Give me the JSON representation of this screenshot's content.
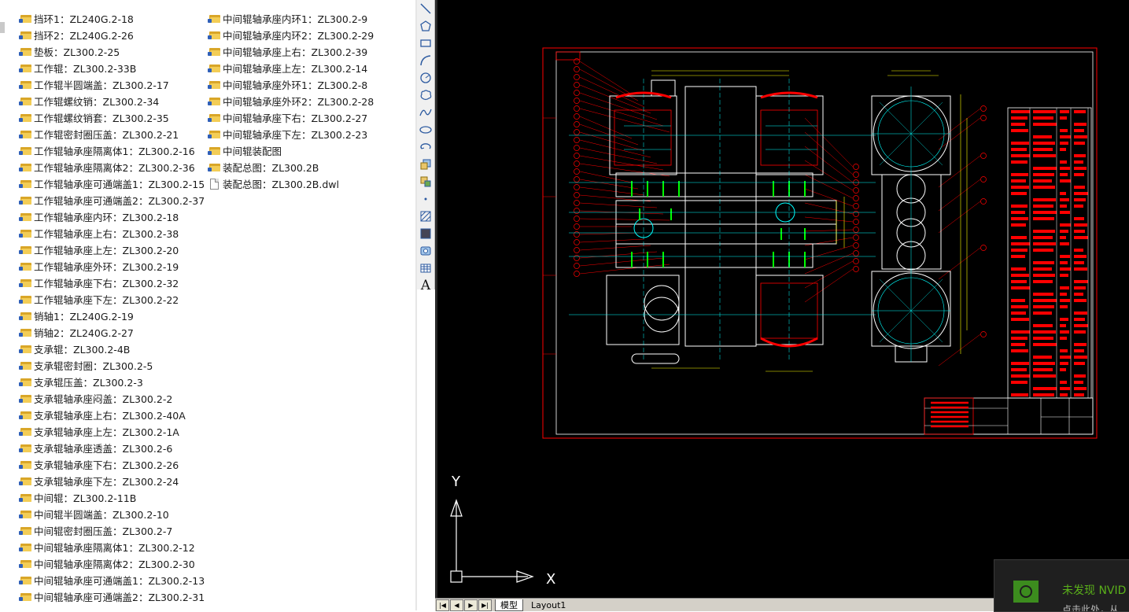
{
  "explorer": {
    "column_a": [
      {
        "name": "挡环1：ZL240G.2-18",
        "type": "folder"
      },
      {
        "name": "挡环2：ZL240G.2-26",
        "type": "folder"
      },
      {
        "name": "垫板：ZL300.2-25",
        "type": "folder"
      },
      {
        "name": "工作辊：ZL300.2-33B",
        "type": "folder"
      },
      {
        "name": "工作辊半圆端盖：ZL300.2-17",
        "type": "folder"
      },
      {
        "name": "工作辊螺纹销：ZL300.2-34",
        "type": "folder"
      },
      {
        "name": "工作辊螺纹销套：ZL300.2-35",
        "type": "folder"
      },
      {
        "name": "工作辊密封圈压盖：ZL300.2-21",
        "type": "folder"
      },
      {
        "name": "工作辊轴承座隔离体1：ZL300.2-16",
        "type": "folder"
      },
      {
        "name": "工作辊轴承座隔离体2：ZL300.2-36",
        "type": "folder"
      },
      {
        "name": "工作辊轴承座可通端盖1：ZL300.2-15",
        "type": "folder"
      },
      {
        "name": "工作辊轴承座可通端盖2：ZL300.2-37",
        "type": "folder"
      },
      {
        "name": "工作辊轴承座内环：ZL300.2-18",
        "type": "folder"
      },
      {
        "name": "工作辊轴承座上右：ZL300.2-38",
        "type": "folder"
      },
      {
        "name": "工作辊轴承座上左：ZL300.2-20",
        "type": "folder"
      },
      {
        "name": "工作辊轴承座外环：ZL300.2-19",
        "type": "folder"
      },
      {
        "name": "工作辊轴承座下右：ZL300.2-32",
        "type": "folder"
      },
      {
        "name": "工作辊轴承座下左：ZL300.2-22",
        "type": "folder"
      },
      {
        "name": "销轴1：ZL240G.2-19",
        "type": "folder"
      },
      {
        "name": "销轴2：ZL240G.2-27",
        "type": "folder"
      },
      {
        "name": "支承辊：ZL300.2-4B",
        "type": "folder"
      },
      {
        "name": "支承辊密封圈：ZL300.2-5",
        "type": "folder"
      },
      {
        "name": "支承辊压盖：ZL300.2-3",
        "type": "folder"
      },
      {
        "name": "支承辊轴承座闷盖：ZL300.2-2",
        "type": "folder"
      },
      {
        "name": "支承辊轴承座上右：ZL300.2-40A",
        "type": "folder"
      },
      {
        "name": "支承辊轴承座上左：ZL300.2-1A",
        "type": "folder"
      },
      {
        "name": "支承辊轴承座透盖：ZL300.2-6",
        "type": "folder"
      },
      {
        "name": "支承辊轴承座下右：ZL300.2-26",
        "type": "folder"
      },
      {
        "name": "支承辊轴承座下左：ZL300.2-24",
        "type": "folder"
      },
      {
        "name": "中间辊：ZL300.2-11B",
        "type": "folder"
      },
      {
        "name": "中间辊半圆端盖：ZL300.2-10",
        "type": "folder"
      },
      {
        "name": "中间辊密封圈压盖：ZL300.2-7",
        "type": "folder"
      },
      {
        "name": "中间辊轴承座隔离体1：ZL300.2-12",
        "type": "folder"
      },
      {
        "name": "中间辊轴承座隔离体2：ZL300.2-30",
        "type": "folder"
      },
      {
        "name": "中间辊轴承座可通端盖1：ZL300.2-13",
        "type": "folder"
      },
      {
        "name": "中间辊轴承座可通端盖2：ZL300.2-31",
        "type": "folder"
      }
    ],
    "column_b": [
      {
        "name": "中间辊轴承座内环1：ZL300.2-9",
        "type": "folder"
      },
      {
        "name": "中间辊轴承座内环2：ZL300.2-29",
        "type": "folder"
      },
      {
        "name": "中间辊轴承座上右：ZL300.2-39",
        "type": "folder"
      },
      {
        "name": "中间辊轴承座上左：ZL300.2-14",
        "type": "folder"
      },
      {
        "name": "中间辊轴承座外环1：ZL300.2-8",
        "type": "folder"
      },
      {
        "name": "中间辊轴承座外环2：ZL300.2-28",
        "type": "folder"
      },
      {
        "name": "中间辊轴承座下右：ZL300.2-27",
        "type": "folder"
      },
      {
        "name": "中间辊轴承座下左：ZL300.2-23",
        "type": "folder"
      },
      {
        "name": "中间辊装配图",
        "type": "folder"
      },
      {
        "name": "装配总图：ZL300.2B",
        "type": "folder"
      },
      {
        "name": "装配总图：ZL300.2B.dwl",
        "type": "file"
      }
    ]
  },
  "toolbar": {
    "tools": [
      "line-tool-icon",
      "polygon-icon",
      "rectangle-icon",
      "arc-icon",
      "circle-icon",
      "revision-cloud-icon",
      "spline-icon",
      "ellipse-icon",
      "ellipse-arc-icon",
      "insert-block-icon",
      "make-block-icon",
      "point-icon",
      "hatch-icon",
      "gradient-icon",
      "region-icon",
      "table-icon",
      "multiline-text-icon"
    ],
    "text_tool_label": "A"
  },
  "canvas": {
    "background": "#000000",
    "ucs": {
      "x_label": "X",
      "y_label": "Y"
    }
  },
  "layout_tabs": {
    "tabs": [
      "模型",
      "Layout1"
    ],
    "active": "模型"
  },
  "notification": {
    "title": "未发现 NVID",
    "subtitle": "点击此处，从",
    "brand_color": "#76b900"
  },
  "colors": {
    "drawing_red": "#ff0000",
    "drawing_white": "#ffffff",
    "drawing_green": "#00ff00",
    "drawing_cyan": "#00ffff",
    "drawing_yellow": "#ffff00"
  }
}
